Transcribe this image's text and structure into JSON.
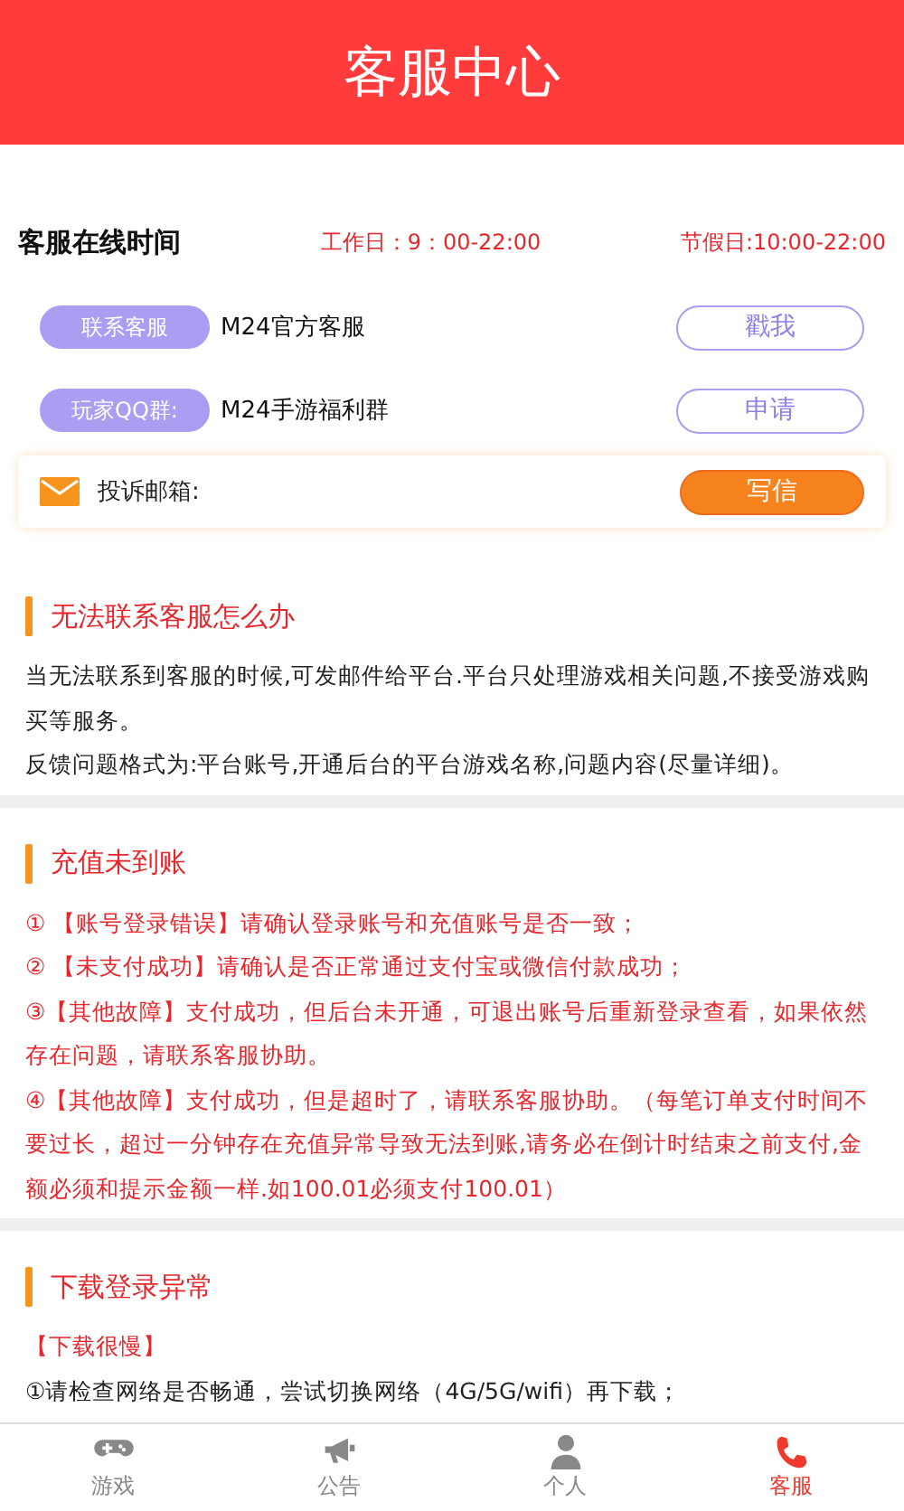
{
  "header": {
    "title": "客服中心"
  },
  "hours": {
    "title": "客服在线时间",
    "workday": "工作日：9：00-22:00",
    "holiday": "节假日:10:00-22:00"
  },
  "contacts": [
    {
      "label": "联系客服",
      "name": "M24官方客服",
      "button": "戳我"
    },
    {
      "label": "玩家QQ群:",
      "name": "M24手游福利群",
      "button": "申请"
    }
  ],
  "complaint": {
    "label": "投诉邮箱:",
    "button": "写信"
  },
  "sections": [
    {
      "title": "无法联系客服怎么办",
      "items": [
        {
          "kind": "text",
          "text": "当无法联系到客服的时候,可发邮件给平台.平台只处理游戏相关问题,不接受游戏购买等服务。"
        },
        {
          "kind": "text",
          "text": "反馈问题格式为:平台账号,开通后台的平台游戏名称,问题内容(尽量详细)。"
        }
      ]
    },
    {
      "title": "充值未到账",
      "items": [
        {
          "kind": "note",
          "text": "① 【账号登录错误】请确认登录账号和充值账号是否一致；"
        },
        {
          "kind": "note",
          "text": "② 【未支付成功】请确认是否正常通过支付宝或微信付款成功；"
        },
        {
          "kind": "note",
          "text": "③【其他故障】支付成功，但后台未开通，可退出账号后重新登录查看，如果依然存在问题，请联系客服协助。"
        },
        {
          "kind": "note",
          "text": "④【其他故障】支付成功，但是超时了，请联系客服协助。（每笔订单支付时间不要过长，超过一分钟存在充值异常导致无法到账,请务必在倒计时结束之前支付,金额必须和提示金额一样.如100.01必须支付100.01）"
        }
      ]
    },
    {
      "title": "下载登录异常",
      "items": [
        {
          "kind": "note",
          "text": "【下载很慢】"
        },
        {
          "kind": "text",
          "text": "①请检查网络是否畅通，尝试切换网络（4G/5G/wifi）再下载；"
        }
      ]
    }
  ],
  "tabs": [
    {
      "label": "游戏",
      "kind": "gamepad",
      "selected": false
    },
    {
      "label": "公告",
      "kind": "megaphone",
      "selected": false
    },
    {
      "label": "个人",
      "kind": "person",
      "selected": false
    },
    {
      "label": "客服",
      "kind": "phone",
      "selected": true
    }
  ]
}
